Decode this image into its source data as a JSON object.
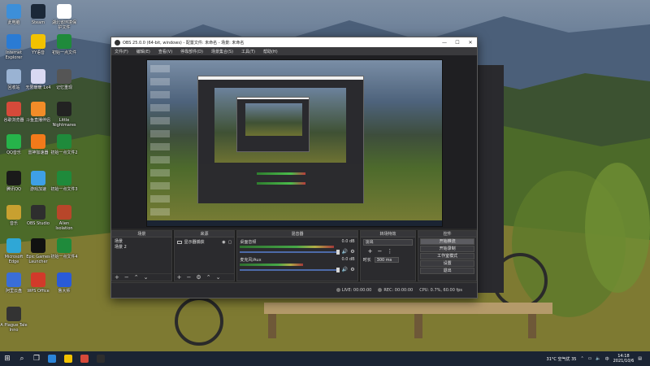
{
  "desktop": {
    "icons": [
      {
        "label": "此电脑",
        "color": "#3d8fd9"
      },
      {
        "label": "Steam",
        "color": "#1b2838"
      },
      {
        "label": "湖北省环境保护文件",
        "color": "#ffffff"
      },
      {
        "label": "Internet Explorer",
        "color": "#2a7bd4"
      },
      {
        "label": "YY语音",
        "color": "#f2c200"
      },
      {
        "label": "初始一点文件",
        "color": "#1f8a3b"
      },
      {
        "label": "回收站",
        "color": "#9ab3d3"
      },
      {
        "label": "无限暖暖 1x4",
        "color": "#d9d9f2"
      },
      {
        "label": "记忆重现",
        "color": "#555555"
      },
      {
        "label": "谷歌浏览器",
        "color": "#d64a3a"
      },
      {
        "label": "斗鱼直播伴侣",
        "color": "#f28c28"
      },
      {
        "label": "Little Nightmares",
        "color": "#222222"
      },
      {
        "label": "QQ音乐",
        "color": "#26b34a"
      },
      {
        "label": "雷神加速器",
        "color": "#f27a1a"
      },
      {
        "label": "初始一点文件2",
        "color": "#1f8a3b"
      },
      {
        "label": "腾讯QQ",
        "color": "#1a1a1a"
      },
      {
        "label": "游戏加速",
        "color": "#3ea0e6"
      },
      {
        "label": "初始一点文件3",
        "color": "#1f8a3b"
      },
      {
        "label": "音乐",
        "color": "#c8a030"
      },
      {
        "label": "OBS Studio",
        "color": "#2e2e2e"
      },
      {
        "label": "Alien Isolation",
        "color": "#b8462a"
      },
      {
        "label": "Microsoft Edge",
        "color": "#2fa7d6"
      },
      {
        "label": "Epic Games Launcher",
        "color": "#111111"
      },
      {
        "label": "初始一点文件4",
        "color": "#1f8a3b"
      },
      {
        "label": "阿里云盘",
        "color": "#3a6ed8"
      },
      {
        "label": "WPS Office",
        "color": "#d23a2a"
      },
      {
        "label": "鲁大师",
        "color": "#2a5bd8"
      },
      {
        "label": "A Plague Tale Inno",
        "color": "#333333"
      }
    ]
  },
  "obs": {
    "title": "OBS 25.0.0 (64-bit, windows) - 配置文件: 未命名 - 场景: 未命名",
    "window_controls": {
      "minimize": "—",
      "maximize": "☐",
      "close": "✕"
    },
    "menu": [
      "文件(F)",
      "编辑(E)",
      "查看(V)",
      "停靠部件(D)",
      "场景集合(S)",
      "工具(T)",
      "帮助(H)"
    ],
    "docks": {
      "scenes": {
        "header": "场景",
        "items": [
          "场景",
          "场景 2"
        ]
      },
      "sources": {
        "header": "来源",
        "items": [
          {
            "label": "显示器捕获"
          }
        ]
      },
      "mixer": {
        "header": "混音器",
        "tracks": [
          {
            "name": "桌面音频",
            "db": "0.0 dB",
            "level": 0.82
          },
          {
            "name": "麦克风/Aux",
            "db": "0.0 dB",
            "level": 0.55
          }
        ]
      },
      "transitions": {
        "header": "转场特效",
        "selected": "淡出",
        "duration_label": "时长",
        "duration_value": "300 ms"
      },
      "controls": {
        "header": "控件",
        "buttons": [
          "开始推流",
          "开始录制",
          "工作室模式",
          "设置",
          "退出"
        ]
      }
    },
    "status": {
      "live": "LIVE: 00:00:00",
      "rec": "REC: 00:00:00",
      "cpu": "CPU: 0.7%, 60.00 fps"
    }
  },
  "taskbar": {
    "weather": "31°C 空气优 35",
    "time": "14:18",
    "date": "2021/10/6",
    "apps": [
      {
        "color": "#2b84d8"
      },
      {
        "color": "#f2c200"
      },
      {
        "color": "#d64a3a"
      },
      {
        "color": "#2e2e2e"
      }
    ]
  },
  "colors": {
    "obs_bg": "#292929",
    "taskbar": "#1b2433",
    "meter_green": "#4bbd4b",
    "meter_red": "#b83b3b"
  }
}
